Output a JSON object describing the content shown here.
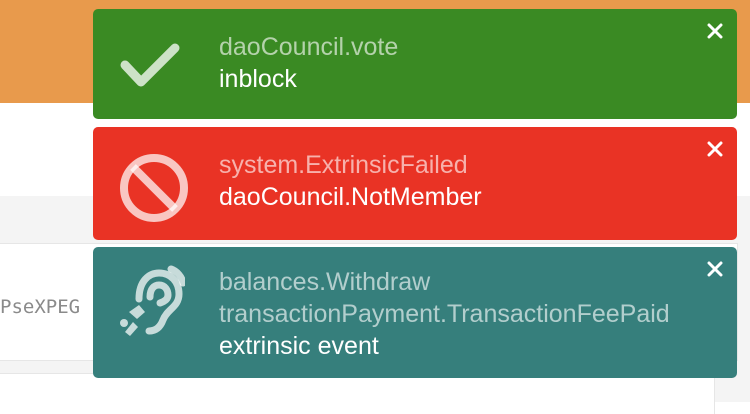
{
  "colors": {
    "top_bar": "#e89a4c",
    "success": "#3a8a23",
    "error": "#e93325",
    "info": "#367f7c"
  },
  "background": {
    "truncated_address": "PseXPEG"
  },
  "toasts": [
    {
      "status": "success",
      "icon": "check-icon",
      "section": "daoCouncil.vote",
      "message": "inblock"
    },
    {
      "status": "error",
      "icon": "ban-icon",
      "section": "system.ExtrinsicFailed",
      "message": "daoCouncil.NotMember"
    },
    {
      "status": "info",
      "icon": "assistive-listening-icon",
      "section": "balances.Withdraw",
      "section2": "transactionPayment.TransactionFeePaid",
      "message": "extrinsic event"
    }
  ]
}
